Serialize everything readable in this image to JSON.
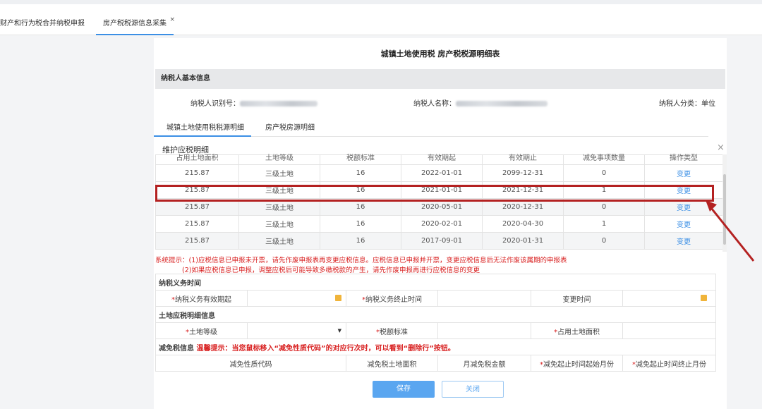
{
  "tabs": [
    {
      "label": "财产和行为税合并纳税申报"
    },
    {
      "label": "房产税税源信息采集",
      "close": "×"
    }
  ],
  "title": "城镇土地使用税 房产税税源明细表",
  "basic_info": {
    "section": "纳税人基本信息",
    "taxpayer_id_label": "纳税人识别号：",
    "taxpayer_name_label": "纳税人名称：",
    "taxpayer_type_label": "纳税人分类：",
    "taxpayer_type_value": "单位"
  },
  "subtabs": [
    "城镇土地使用税税源明细",
    "房产税房源明细"
  ],
  "maint": {
    "title": "维护应税明细",
    "close": "×",
    "headers": [
      "占用土地面积",
      "土地等级",
      "税额标准",
      "有效期起",
      "有效期止",
      "减免事项数量",
      "操作类型"
    ],
    "rows": [
      [
        "215.87",
        "三级土地",
        "16",
        "2022-01-01",
        "2099-12-31",
        "0",
        "变更"
      ],
      [
        "215.87",
        "三级土地",
        "16",
        "2021-01-01",
        "2021-12-31",
        "1",
        "变更"
      ],
      [
        "215.87",
        "三级土地",
        "16",
        "2020-05-01",
        "2020-12-31",
        "0",
        "变更"
      ],
      [
        "215.87",
        "三级土地",
        "16",
        "2020-02-01",
        "2020-04-30",
        "1",
        "变更"
      ],
      [
        "215.87",
        "三级土地",
        "16",
        "2017-09-01",
        "2020-01-31",
        "0",
        "变更"
      ]
    ]
  },
  "hints": [
    "系统提示：(1)应税信息已申报未开票，请先作废申报表再变更应税信息。应税信息已申报并开票，变更应税信息后无法作废该属期的申报表",
    "(2)如果应税信息已申报，调整应税后可能导致多缴税款的产生，请先作废申报再进行应税信息的变更"
  ],
  "form": {
    "obligation_section": "纳税义务时间",
    "start_label": "纳税义务有效期起",
    "end_label": "纳税义务终止时间",
    "change_time_label": "变更时间",
    "land_section": "土地应税明细信息",
    "land_grade_label": "土地等级",
    "tax_standard_label": "税额标准",
    "area_label": "占用土地面积",
    "relief_section": "减免税信息",
    "relief_warn": "温馨提示：当您鼠标移入“减免性质代码”的对应行次时，可以看到“删除行”按钮。",
    "relief_headers": [
      "减免性质代码",
      "减免税土地面积",
      "月减免税金额",
      "减免起止时间起始月份",
      "减免起止时间终止月份"
    ],
    "required_mark": "*",
    "dropdown_caret": "▼"
  },
  "buttons": {
    "save": "保存",
    "close": "关闭"
  },
  "colors": {
    "accent": "#3b8fe5",
    "highlight": "#b42121",
    "warning": "#d81e1e"
  }
}
